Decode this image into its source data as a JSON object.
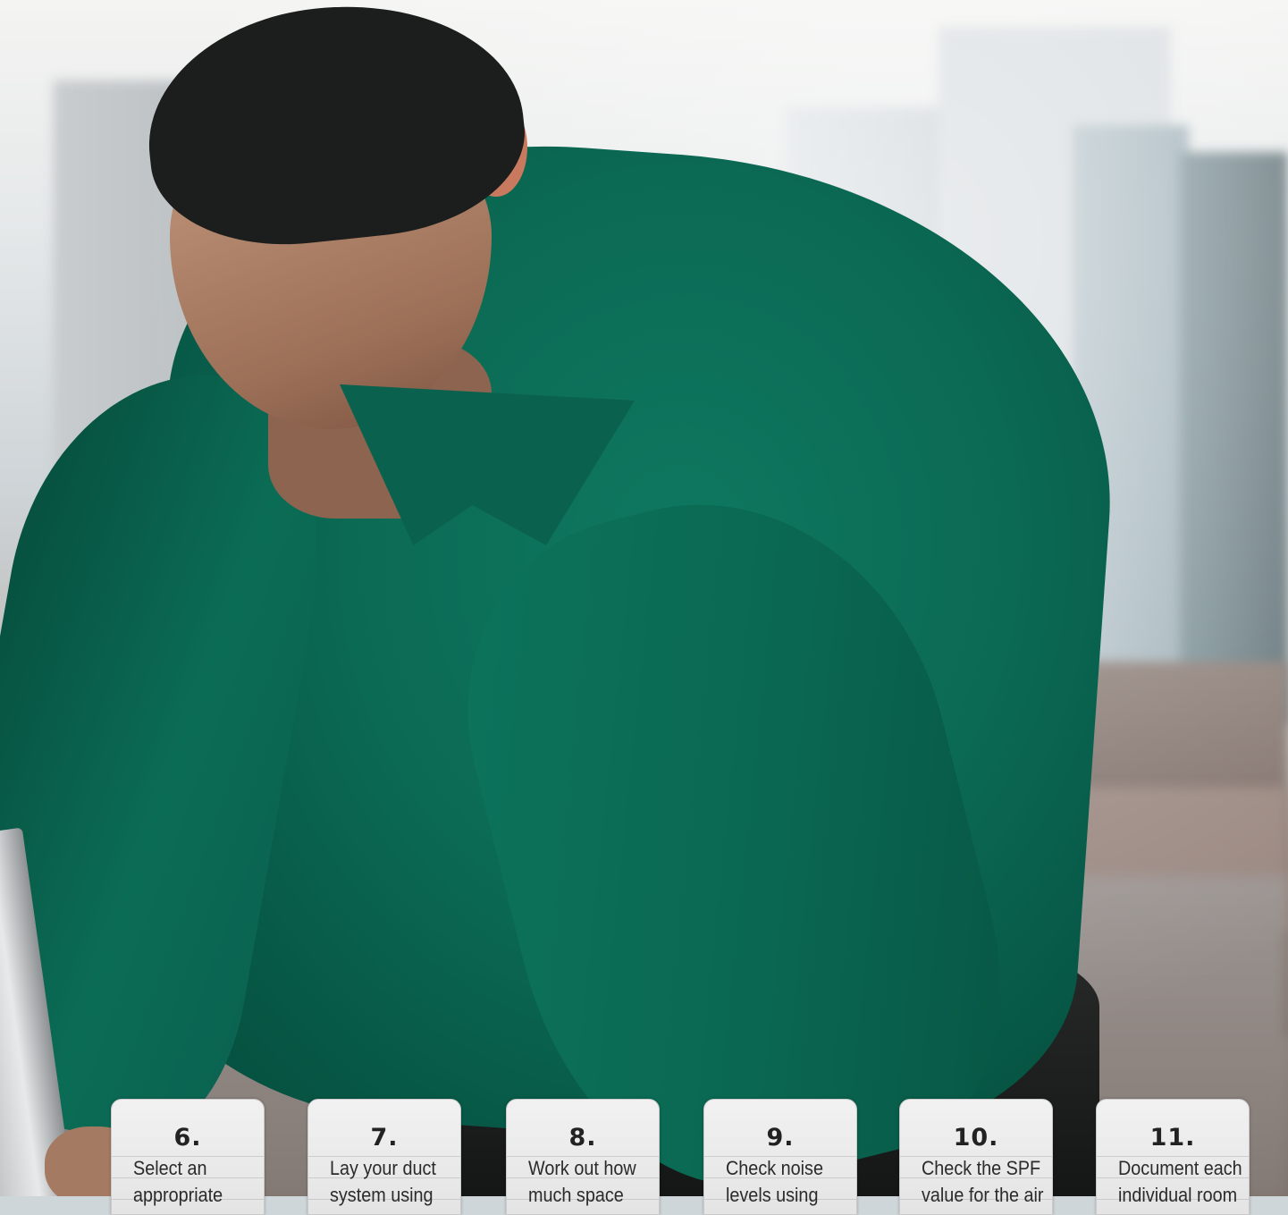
{
  "steps": [
    {
      "number": "6.",
      "text": "Select an appropriate"
    },
    {
      "number": "7.",
      "text": "Lay your duct system using"
    },
    {
      "number": "8.",
      "text": "Work out how much space"
    },
    {
      "number": "9.",
      "text": "Check noise levels using"
    },
    {
      "number": "10.",
      "text": "Check the SPF value for the air"
    },
    {
      "number": "11.",
      "text": "Document each individual room"
    }
  ],
  "colors": {
    "sweater": "#0b6a54",
    "tab_background": "#e8e8e8",
    "tab_text": "#222222"
  }
}
